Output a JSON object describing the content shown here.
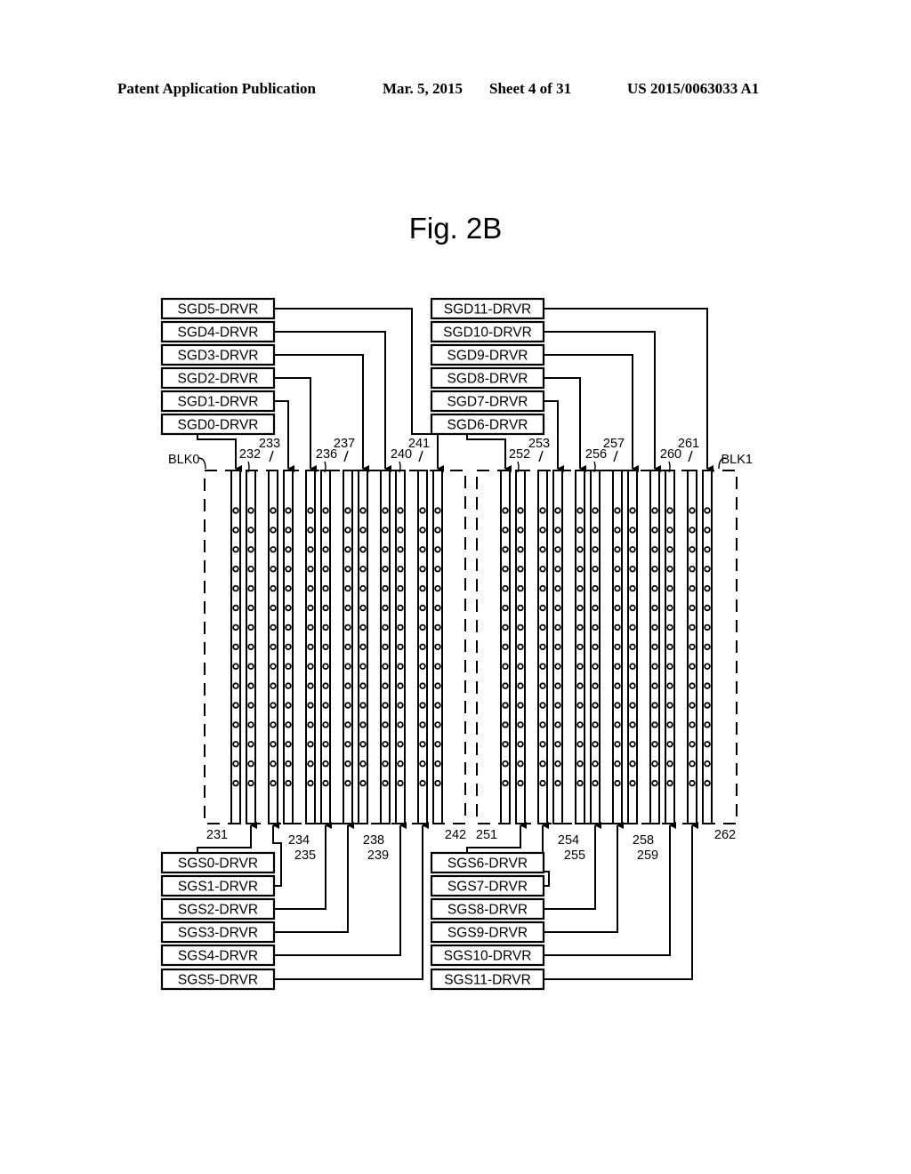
{
  "header": {
    "publication": "Patent Application Publication",
    "date": "Mar. 5, 2015",
    "sheet": "Sheet 4 of 31",
    "number": "US 2015/0063033 A1"
  },
  "figure": {
    "title": "Fig. 2B",
    "blocks": [
      {
        "label": "BLK0",
        "sgd_drivers": [
          "SGD0-DRVR",
          "SGD1-DRVR",
          "SGD2-DRVR",
          "SGD3-DRVR",
          "SGD4-DRVR",
          "SGD5-DRVR"
        ],
        "sgs_drivers": [
          "SGS0-DRVR",
          "SGS1-DRVR",
          "SGS2-DRVR",
          "SGS3-DRVR",
          "SGS4-DRVR",
          "SGS5-DRVR"
        ],
        "top_refs": [
          "232",
          "233",
          "236",
          "237",
          "240",
          "241"
        ],
        "bottom_refs": [
          "231",
          "234",
          "235",
          "238",
          "239",
          "242"
        ]
      },
      {
        "label": "BLK1",
        "sgd_drivers": [
          "SGD6-DRVR",
          "SGD7-DRVR",
          "SGD8-DRVR",
          "SGD9-DRVR",
          "SGD10-DRVR",
          "SGD11-DRVR"
        ],
        "sgs_drivers": [
          "SGS6-DRVR",
          "SGS7-DRVR",
          "SGS8-DRVR",
          "SGS9-DRVR",
          "SGS10-DRVR",
          "SGS11-DRVR"
        ],
        "top_refs": [
          "252",
          "253",
          "256",
          "257",
          "260",
          "261"
        ],
        "bottom_refs": [
          "251",
          "254",
          "255",
          "258",
          "259",
          "262"
        ]
      }
    ],
    "columns_per_block": 12,
    "memory_holes_per_column": 15
  }
}
